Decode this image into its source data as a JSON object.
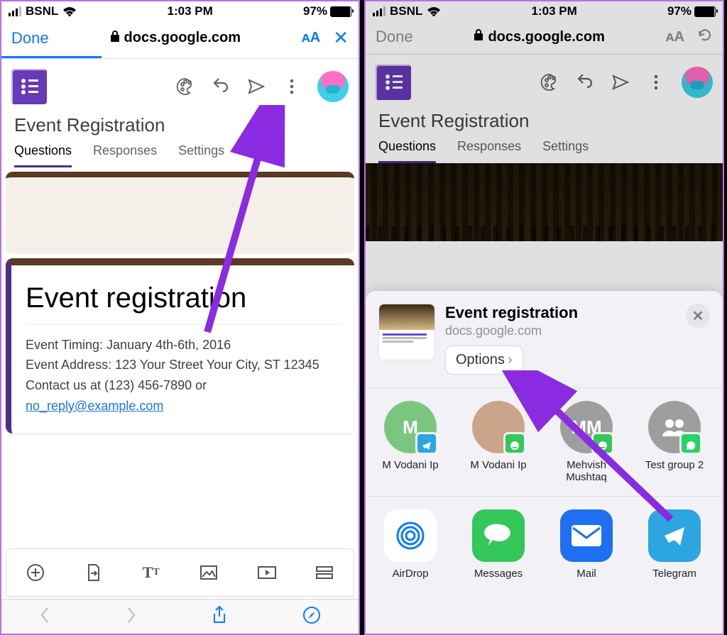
{
  "status": {
    "carrier": "BSNL",
    "time": "1:03 PM",
    "battery": "97%"
  },
  "safari": {
    "done": "Done",
    "url": "docs.google.com",
    "aa": "ᴀA"
  },
  "appbar": {},
  "doc": {
    "title": "Event Registration"
  },
  "tabs": {
    "questions": "Questions",
    "responses": "Responses",
    "settings": "Settings"
  },
  "form": {
    "title": "Event registration",
    "line1": "Event Timing: January 4th-6th, 2016",
    "line2": "Event Address: 123 Your Street Your City, ST 12345",
    "line3_pre": "Contact us at (123) 456-7890 or ",
    "email": "no_reply@example.com"
  },
  "sheet": {
    "title": "Event registration",
    "subtitle": "docs.google.com",
    "options": "Options",
    "contacts": [
      {
        "name": "M Vodani Ip",
        "avatar": "M",
        "bg": "#7bc67e",
        "badge": "telegram"
      },
      {
        "name": "M Vodani Ip",
        "avatar": "photo",
        "bg": "#caa58a",
        "badge": "imessage"
      },
      {
        "name": "Mehvish Mushtaq",
        "avatar": "MM",
        "bg": "#9e9e9e",
        "badge": "imessage"
      },
      {
        "name": "Test group 2",
        "avatar": "group",
        "bg": "#9e9e9e",
        "badge": "whatsapp"
      }
    ],
    "apps": [
      {
        "name": "AirDrop",
        "icon": "airdrop"
      },
      {
        "name": "Messages",
        "icon": "messages"
      },
      {
        "name": "Mail",
        "icon": "mail"
      },
      {
        "name": "Telegram",
        "icon": "telegram"
      }
    ]
  }
}
